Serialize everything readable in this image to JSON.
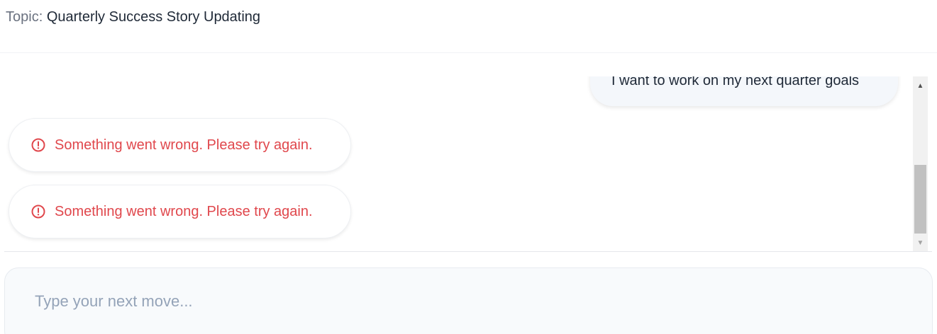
{
  "header": {
    "topic_prefix": "Topic:",
    "topic_title": "Quarterly Success Story Updating"
  },
  "messages": {
    "user_message": "I want to work on my next quarter goals",
    "errors": [
      {
        "text": "Something went wrong. Please try again.",
        "icon": "alert-circle-icon"
      },
      {
        "text": "Something went wrong. Please try again.",
        "icon": "alert-circle-icon"
      }
    ]
  },
  "scrollbar": {
    "up_arrow": "▲",
    "down_arrow": "▼"
  },
  "input": {
    "placeholder": "Type your next move...",
    "value": ""
  },
  "colors": {
    "error": "#e0474c",
    "user_bubble": "#f4f7fb",
    "topic_title": "#1f2937"
  }
}
